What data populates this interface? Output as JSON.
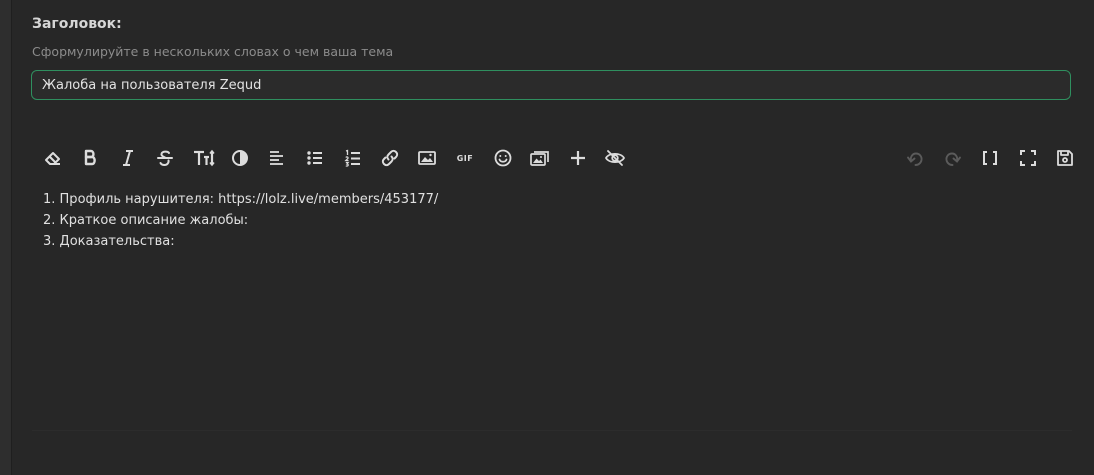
{
  "form": {
    "title_label": "Заголовок:",
    "title_hint": "Сформулируйте в нескольких словах о чем ваша тема",
    "title_value": "Жалоба на пользователя Zequd",
    "accent_color": "#2f8f5f"
  },
  "toolbar": {
    "gif_label": "GIF",
    "buttons": [
      {
        "icon": "eraser-icon"
      },
      {
        "icon": "bold-icon"
      },
      {
        "icon": "italic-icon"
      },
      {
        "icon": "strikethrough-icon"
      },
      {
        "icon": "text-size-icon"
      },
      {
        "icon": "contrast-icon"
      },
      {
        "icon": "align-left-icon"
      },
      {
        "icon": "bulleted-list-icon"
      },
      {
        "icon": "numbered-list-icon"
      },
      {
        "icon": "link-icon"
      },
      {
        "icon": "image-icon"
      },
      {
        "icon": "gif-icon"
      },
      {
        "icon": "emoji-icon"
      },
      {
        "icon": "gallery-icon"
      },
      {
        "icon": "plus-icon"
      },
      {
        "icon": "hide-icon"
      },
      {
        "icon": "undo-icon",
        "disabled": true
      },
      {
        "icon": "redo-icon",
        "disabled": true
      },
      {
        "icon": "brackets-icon"
      },
      {
        "icon": "fullscreen-icon"
      },
      {
        "icon": "save-draft-icon"
      }
    ]
  },
  "editor": {
    "lines": [
      "1. Профиль нарушителя: https://lolz.live/members/453177/",
      "2. Краткое описание жалобы:",
      "3. Доказательства:"
    ]
  }
}
